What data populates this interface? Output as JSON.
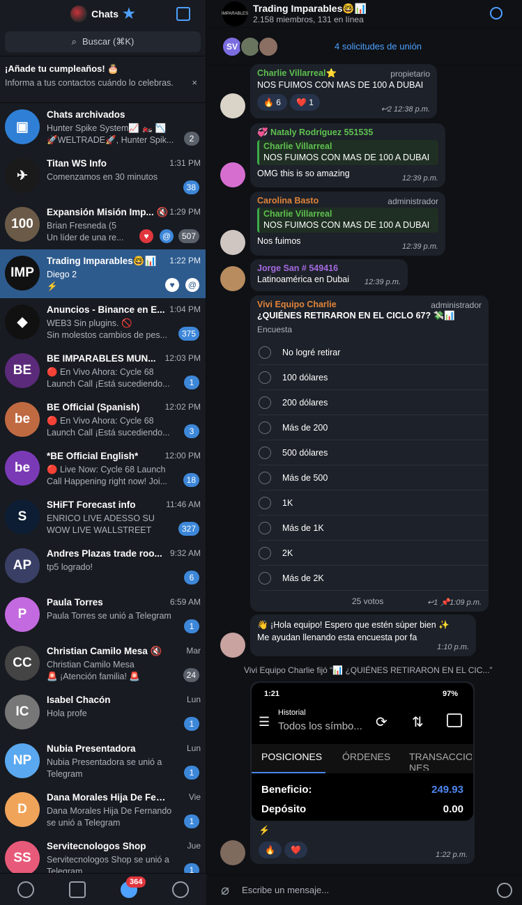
{
  "left": {
    "title": "Chats",
    "search_placeholder": "Buscar (⌘K)",
    "birthday_title": "¡Añade tu cumpleaños! 🎂",
    "birthday_desc": "Informa a tus contactos cuándo lo celebras.",
    "close": "×"
  },
  "chats": [
    {
      "name": "Chats archivados",
      "time": "",
      "line1": "Hunter Spike System📈 🏍️ 📉",
      "line2": "🚀WELTRADE🚀, Hunter Spik...",
      "badge": "2",
      "badge_gray": true,
      "color": "#2f7fd6",
      "initials": "▣"
    },
    {
      "name": "Titan WS Info",
      "time": "1:31 PM",
      "line1": "Comenzamos en 30 minutos",
      "line2": "",
      "badge": "38",
      "color": "#1a1a1a",
      "initials": "✈"
    },
    {
      "name": "Expansión Misión Imp... 🔇",
      "time": "1:29 PM",
      "line1": "Brian Fresneda (5",
      "line2": "Un líder de una re...",
      "badge": "507",
      "badge_gray": true,
      "color": "#6b5a48",
      "initials": "100"
    },
    {
      "name": "Trading Imparables🤓📊",
      "time": "1:22 PM",
      "line1": "Diego 2",
      "line2": "⚡",
      "badge": "",
      "color": "#111",
      "initials": "IMP",
      "active": true
    },
    {
      "name": "Anuncios - Binance en E...",
      "time": "1:04 PM",
      "line1": "WEB3 Sin plugins. 🚫",
      "line2": "Sin molestos cambios de pes...",
      "badge": "375",
      "color": "#111",
      "initials": "◆"
    },
    {
      "name": "BE IMPARABLES MUN...",
      "time": "12:03 PM",
      "line1": "🔴 En Vivo Ahora: Cycle 68",
      "line2": "Launch Call ¡Está sucediendo...",
      "badge": "1",
      "color": "#5b2a7a",
      "initials": "BE"
    },
    {
      "name": "BE Official (Spanish)",
      "time": "12:02 PM",
      "line1": "🔴 En Vivo Ahora: Cycle 68",
      "line2": "Launch Call ¡Está sucediendo...",
      "badge": "3",
      "color": "#c06a42",
      "initials": "be"
    },
    {
      "name": "*BE Official English*",
      "time": "12:00 PM",
      "line1": "🔴 Live Now: Cycle 68 Launch",
      "line2": "Call Happening right now! Joi...",
      "badge": "18",
      "color": "#7a3ab5",
      "initials": "be"
    },
    {
      "name": "SHiFT Forecast info",
      "time": "11:46 AM",
      "line1": "ENRICO LIVE ADESSO SU",
      "line2": "WOW LIVE WALLSTREET",
      "badge": "327",
      "color": "#0d1d33",
      "initials": "S"
    },
    {
      "name": "Andres Plazas trade roo...",
      "time": "9:32 AM",
      "line1": "tp5 logrado!",
      "line2": "",
      "badge": "6",
      "color": "#3a3f66",
      "initials": "AP"
    },
    {
      "name": "Paula Torres",
      "time": "6:59 AM",
      "line1": "Paula Torres se unió a Telegram",
      "line2": "",
      "badge": "1",
      "color": "#c46ae0",
      "initials": "P"
    },
    {
      "name": "Christian Camilo Mesa 🔇",
      "time": "Mar",
      "line1": "Christian Camilo Mesa",
      "line2": "🚨 ¡Atención familia! 🚨",
      "badge": "24",
      "badge_gray": true,
      "color": "#444",
      "initials": "CC"
    },
    {
      "name": "Isabel Chacón",
      "time": "Lun",
      "line1": "Hola profe",
      "line2": "",
      "badge": "1",
      "color": "#777",
      "initials": "IC"
    },
    {
      "name": "Nubia Presentadora",
      "time": "Lun",
      "line1": "Nubia Presentadora se unió a",
      "line2": "Telegram",
      "badge": "1",
      "color": "#5aa8f0",
      "initials": "NP"
    },
    {
      "name": "Dana Morales Hija De Ferna...",
      "time": "Vie",
      "line1": "Dana Morales Hija De Fernando",
      "line2": "se unió a Telegram",
      "badge": "1",
      "color": "#f0a45a",
      "initials": "D"
    },
    {
      "name": "Servitecnologos Shop",
      "time": "Jue",
      "line1": "Servitecnologos Shop se unió a",
      "line2": "Telegram",
      "badge": "1",
      "color": "#e85a7a",
      "initials": "SS"
    }
  ],
  "nav": {
    "badge": "364"
  },
  "header": {
    "title": "Trading Imparables🤓📊",
    "subtitle": "2.158 miembros, 131 en línea",
    "avatar_text": "IMPARABLES"
  },
  "join": {
    "initials": "SV",
    "text": "4 solicitudes de unión"
  },
  "messages": {
    "m1": {
      "name": "Charlie Villarreal⭐",
      "role": "propietario",
      "text": "NOS FUIMOS CON MAS DE 100 A DUBAI",
      "r1": "🔥 6",
      "r2": "❤️ 1",
      "time": "↩2 12:38 p.m."
    },
    "m2": {
      "name": "💞 Nataly Rodríguez 551535",
      "qname": "Charlie Villarreal",
      "qtext": "NOS FUIMOS CON MAS DE 100 A DUBAI",
      "text": "OMG this is so amazing",
      "time": "12:39 p.m."
    },
    "m3": {
      "name": "Carolina Basto",
      "role": "administrador",
      "qname": "Charlie Villarreal",
      "qtext": "NOS FUIMOS CON MAS DE 100 A DUBAI",
      "text": "Nos fuimos",
      "time": "12:39 p.m."
    },
    "m4": {
      "name": "Jorge San # 549416",
      "text": "Latinoamérica en Dubai",
      "time": "12:39 p.m."
    },
    "poll": {
      "name": "Vivi Equipo Charlie",
      "role": "administrador",
      "question": "¿QUIÉNES RETIRARON EN EL CICLO 67? 💸📊",
      "label": "Encuesta",
      "options": [
        "No logré retirar",
        "100 dólares",
        "200 dólares",
        "Más de 200",
        "500 dólares",
        "Más de 500",
        "1K",
        "Más de 1K",
        "2K",
        "Más de 2K"
      ],
      "votes": "25 votos",
      "time": "↩1 📌1:09 p.m."
    },
    "m5": {
      "text1": "👋 ¡Hola equipo! Espero que estén súper bien ✨",
      "text2": "Me ayudan llenando esta encuesta por fa",
      "time": "1:10 p.m."
    },
    "pinned": "Vivi Equipo Charlie fijó “📊 ¿QUIÉNES RETIRARON EN EL CIC...”",
    "phone": {
      "clock": "1:21",
      "battery": "97%",
      "hist": "Historial",
      "sym": "Todos los símbo...",
      "tab1": "POSICIONES",
      "tab2": "ÓRDENES",
      "tab3": "TRANSACCIO NES",
      "ben_l": "Beneficio:",
      "ben_v": "249.93",
      "dep_l": "Depósito",
      "dep_v": "0.00"
    },
    "m6": {
      "text": "⚡",
      "r1": "🔥",
      "r2": "❤️",
      "time": "1:22 p.m."
    }
  },
  "composer": {
    "placeholder": "Escribe un mensaje..."
  }
}
